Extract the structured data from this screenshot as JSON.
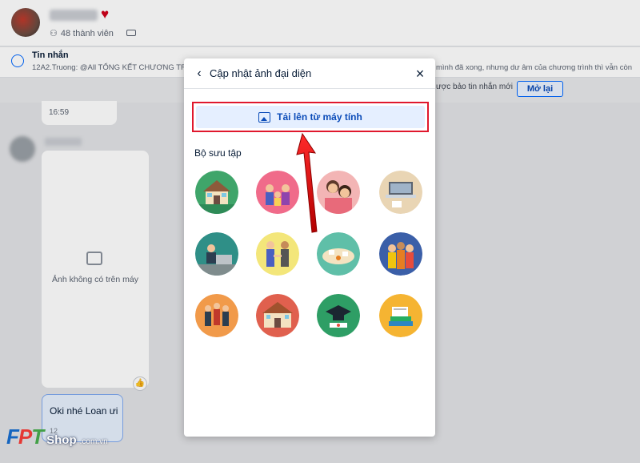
{
  "chat_header": {
    "member_count": "48 thành viên"
  },
  "pinned": {
    "title": "Tin nhắn",
    "preview": "12A2.Truong: @All TỔNG KẾT CHƯƠNG TR",
    "preview_right": "mình đã xong, nhưng dư âm của chương trình thì vẫn còn"
  },
  "notify": {
    "text": "ược bảo tin nhắn mới",
    "reopen_label": "Mở lại"
  },
  "messages": {
    "time_1": "16:59",
    "image_missing": "Ảnh không có trên máy",
    "reply_text": "Oki nhé Loan ưi",
    "reply_time": "12"
  },
  "modal": {
    "title": "Cập nhật ảnh đại diện",
    "back_icon": "‹",
    "close_icon": "×",
    "upload_label": "Tải lên từ máy tính",
    "collection_title": "Bộ sưu tập",
    "thumbnails": [
      {
        "name": "house",
        "bg": "#3fa56a"
      },
      {
        "name": "family",
        "bg": "#f06b8a"
      },
      {
        "name": "family-hug",
        "bg": "#e86a7a"
      },
      {
        "name": "desk-laptop",
        "bg": "#e9d5b4"
      },
      {
        "name": "office-worker",
        "bg": "#2f8f87"
      },
      {
        "name": "handshake",
        "bg": "#f3e67a"
      },
      {
        "name": "coffee-table",
        "bg": "#5fbfa8"
      },
      {
        "name": "friends",
        "bg": "#3b5fa8"
      },
      {
        "name": "celebration",
        "bg": "#f19a4a"
      },
      {
        "name": "school",
        "bg": "#e0604e"
      },
      {
        "name": "graduation",
        "bg": "#2e9e65"
      },
      {
        "name": "books",
        "bg": "#f5b432"
      }
    ]
  },
  "brand": {
    "f": "F",
    "p": "P",
    "t": "T",
    "shop": "Shop",
    "domain": ".com.vn"
  },
  "colors": {
    "accent": "#0068ff",
    "highlight_red": "#e0182d",
    "upload_bg": "#e5efff"
  }
}
